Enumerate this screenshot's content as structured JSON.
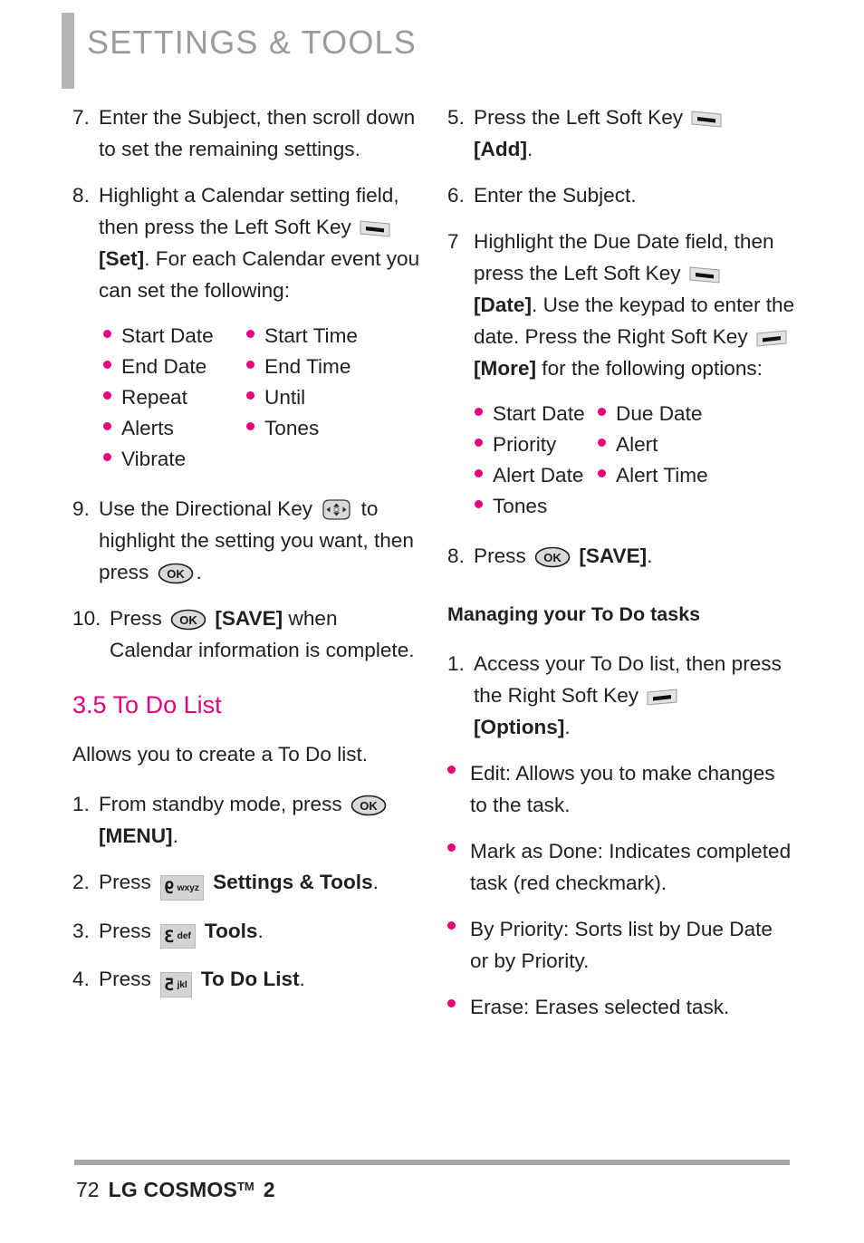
{
  "header": {
    "title": "SETTINGS & TOOLS",
    "accent_color": "#e6007e",
    "header_gray": "#9b9b9b"
  },
  "left_column": {
    "steps": [
      {
        "num": "7.",
        "text": "Enter the Subject, then scroll down to set the remaining settings."
      },
      {
        "num": "8.",
        "text_a": "Highlight a Calendar setting field, then press the Left Soft Key ",
        "icon": "left-soft-key",
        "bold_b": "[Set]",
        "text_b": ". For each Calendar event you can set the following:"
      }
    ],
    "calendar_options_col1": [
      "Start Date",
      "End Date",
      "Repeat",
      "Alerts",
      "Vibrate"
    ],
    "calendar_options_col2": [
      "Start Time",
      "End Time",
      "Until",
      "Tones"
    ],
    "step9": {
      "num": "9.",
      "text_a": "Use the Directional Key ",
      "icon1": "directional-key",
      "text_b": " to highlight the setting you want, then press ",
      "icon2": "ok-key",
      "text_c": "."
    },
    "step10": {
      "num": "10.",
      "text_a": "Press ",
      "icon": "ok-key",
      "bold_b": "[SAVE]",
      "text_b": " when Calendar information is complete."
    },
    "section_title": "3.5 To Do List",
    "intro": "Allows you to create a To Do list.",
    "todo_steps": [
      {
        "num": "1.",
        "text_a": "From standby mode, press ",
        "icon": "ok-key",
        "bold_b": "[MENU]",
        "text_b": "."
      },
      {
        "num": "2.",
        "text_a": "Press ",
        "key_digit": "9",
        "key_letters": "wxyz",
        "bold_b": "Settings & Tools",
        "text_b": "."
      },
      {
        "num": "3.",
        "text_a": "Press ",
        "key_digit": "3",
        "key_letters": "def",
        "bold_b": "Tools",
        "text_b": "."
      },
      {
        "num": "4.",
        "text_a": "Press ",
        "key_digit": "5",
        "key_letters": "jkl",
        "bold_b": "To Do List",
        "text_b": "."
      }
    ]
  },
  "right_column": {
    "step5": {
      "num": "5.",
      "text_a": "Press the Left Soft Key ",
      "icon": "left-soft-key",
      "bold_b": "[Add]",
      "text_b": "."
    },
    "step6": {
      "num": "6.",
      "text": "Enter the Subject."
    },
    "step7": {
      "num": "7",
      "text_a": "Highlight the Due Date field, then press the Left Soft Key ",
      "icon1": "left-soft-key",
      "bold_b": "[Date]",
      "text_b": ". Use the keypad to enter the date. Press the Right Soft Key ",
      "icon2": "right-soft-key",
      "bold_c": "[More]",
      "text_c": " for the following options:"
    },
    "todo_options_col1": [
      "Start Date",
      "Priority",
      "Alert Date",
      "Tones"
    ],
    "todo_options_col2": [
      "Due Date",
      "Alert",
      "Alert Time"
    ],
    "step8": {
      "num": "8.",
      "text_a": "Press ",
      "icon": "ok-key",
      "bold_b": "[SAVE]",
      "text_b": "."
    },
    "sub_head": "Managing your To Do tasks",
    "manage_step1": {
      "num": "1.",
      "text_a": "Access your To Do list, then press the Right Soft Key ",
      "icon": "right-soft-key",
      "bold_b": "[Options]",
      "text_b": "."
    },
    "option_bullets": [
      "Edit: Allows you to make changes to the task.",
      "Mark as Done: Indicates completed task (red checkmark).",
      "By Priority: Sorts list by Due Date or by Priority.",
      "Erase: Erases selected task."
    ]
  },
  "footer": {
    "page_number": "72",
    "model": "LG COSMOS",
    "tm": "TM",
    "model_suffix": "2"
  }
}
